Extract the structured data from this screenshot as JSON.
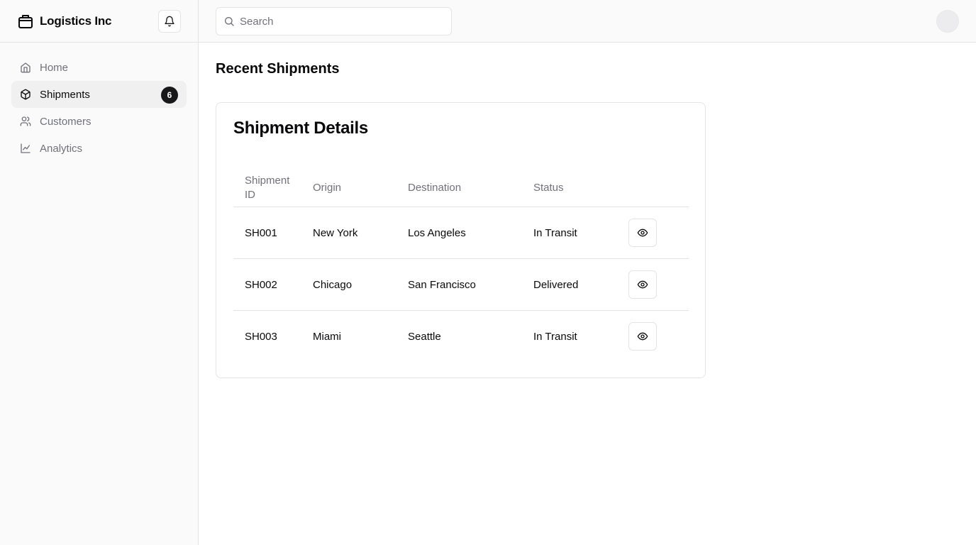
{
  "brand": {
    "name": "Logistics Inc",
    "icon": "package-box-icon"
  },
  "header": {
    "notification_icon": "bell-icon"
  },
  "search": {
    "placeholder": "Search",
    "icon": "search-icon"
  },
  "sidebar": {
    "items": [
      {
        "label": "Home",
        "icon": "home-icon",
        "active": false
      },
      {
        "label": "Shipments",
        "icon": "package-icon",
        "active": true,
        "badge": "6"
      },
      {
        "label": "Customers",
        "icon": "users-icon",
        "active": false
      },
      {
        "label": "Analytics",
        "icon": "line-chart-icon",
        "active": false
      }
    ]
  },
  "main": {
    "title": "Recent Shipments",
    "card_title": "Shipment Details",
    "table": {
      "headers": [
        "Shipment ID",
        "Origin",
        "Destination",
        "Status"
      ],
      "rows": [
        {
          "id": "SH001",
          "origin": "New York",
          "destination": "Los Angeles",
          "status": "In Transit"
        },
        {
          "id": "SH002",
          "origin": "Chicago",
          "destination": "San Francisco",
          "status": "Delivered"
        },
        {
          "id": "SH003",
          "origin": "Miami",
          "destination": "Seattle",
          "status": "In Transit"
        }
      ],
      "action_icon": "eye-icon"
    }
  },
  "colors": {
    "accent": "#18181b",
    "muted_text": "#71717a",
    "border": "#e4e4e7",
    "sidebar_bg": "#fafafa",
    "active_item_bg": "#f0f0f1"
  }
}
